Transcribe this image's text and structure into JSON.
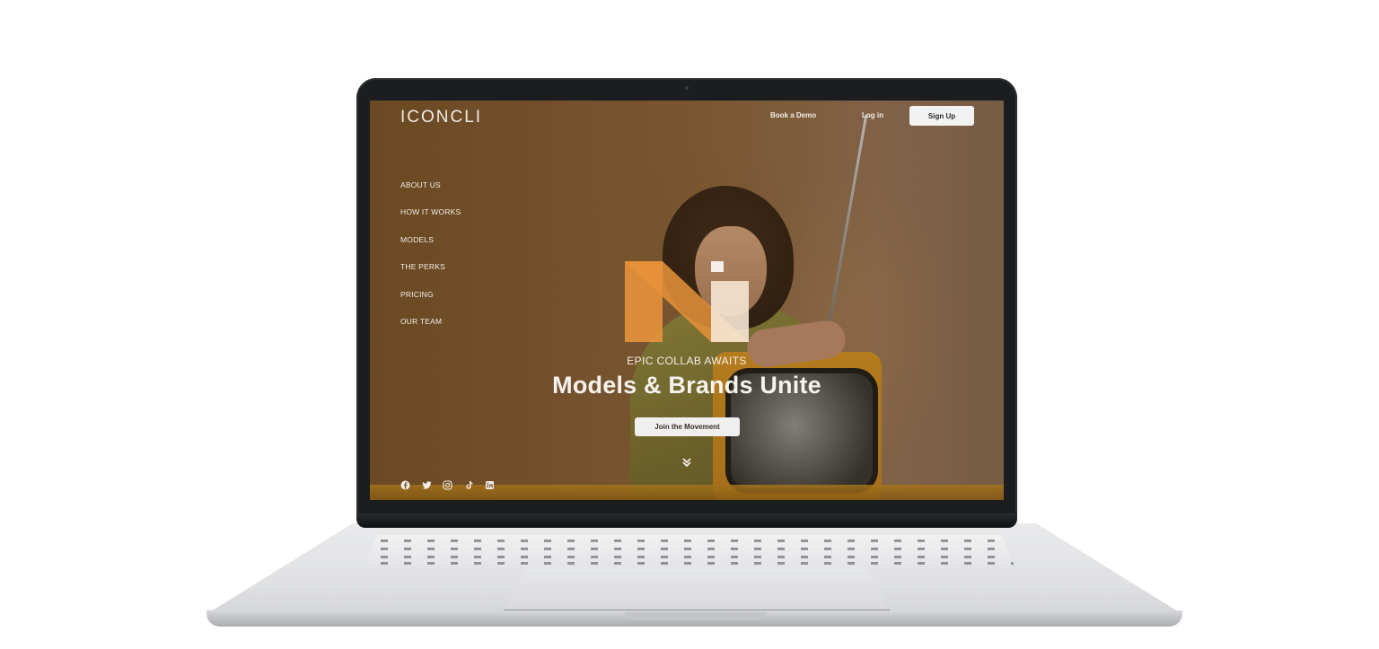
{
  "header": {
    "logo": "ICONCLI",
    "book_demo": "Book a Demo",
    "login": "Log in",
    "signup": "Sign Up"
  },
  "menu": {
    "items": [
      "ABOUT US",
      "HOW IT WORKS",
      "MODELS",
      "THE PERKS",
      "PRICING",
      "OUR TEAM"
    ]
  },
  "hero": {
    "eyebrow": "EPIC COLLAB AWAITS",
    "headline": "Models & Brands Unite",
    "cta": "Join the Movement"
  },
  "icons": {
    "scroll": "chevrons-down-icon",
    "socials": [
      "facebook-icon",
      "twitter-icon",
      "instagram-icon",
      "tiktok-icon",
      "linkedin-icon"
    ]
  },
  "colors": {
    "accent_orange": "#e8923a",
    "screen_bg": "#7a5630",
    "button_bg": "#efefef"
  }
}
